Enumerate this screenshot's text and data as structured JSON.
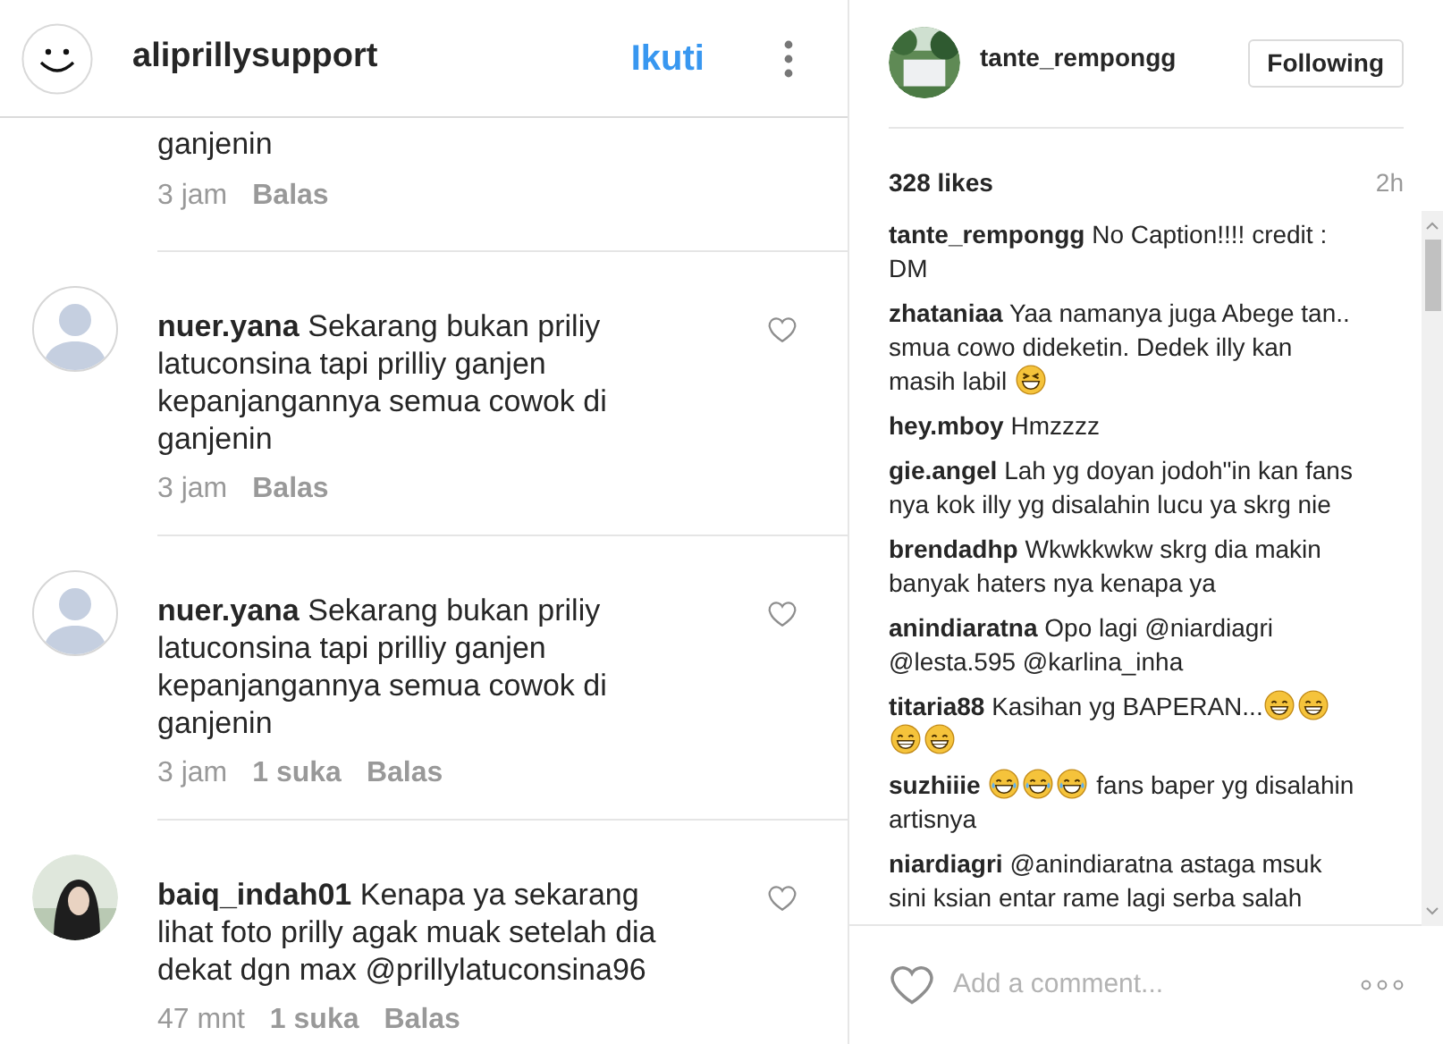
{
  "left": {
    "header": {
      "username": "aliprillysupport",
      "follow": "Ikuti"
    },
    "partial_comment": {
      "text": "ganjenin",
      "time": "3 jam",
      "reply": "Balas"
    },
    "comments": [
      {
        "avatar": {
          "kind": "default"
        },
        "username": "nuer.yana",
        "text": "Sekarang bukan priliy latuconsina tapi prilliy ganjen kepanjangannya semua cowok di ganjenin",
        "time": "3 jam",
        "reply": "Balas"
      },
      {
        "avatar": {
          "kind": "default"
        },
        "username": "nuer.yana",
        "text": "Sekarang bukan priliy latuconsina tapi prilliy ganjen kepanjangannya semua cowok di ganjenin",
        "time": "3 jam",
        "likes": "1 suka",
        "reply": "Balas"
      },
      {
        "username": "baiq_indah01",
        "text": "Kenapa ya sekarang lihat foto prilly agak muak setelah dia dekat dgn max @prillylatuconsina96",
        "time": "47 mnt",
        "likes": "1 suka",
        "reply": "Balas"
      }
    ]
  },
  "right": {
    "header": {
      "username": "tante_rempongg",
      "button": "Following"
    },
    "likes": "328 likes",
    "time": "2h",
    "comments": [
      {
        "username": "tante_rempongg",
        "parts": [
          {
            "kind": "text",
            "text": "No Caption!!!! credit : DM"
          }
        ]
      },
      {
        "username": "zhataniaa",
        "parts": [
          {
            "kind": "text",
            "text": "Yaa namanya juga Abege tan.. smua cowo dideketin. Dedek illy kan masih labil "
          },
          {
            "kind": "squint-emoji"
          }
        ]
      },
      {
        "username": "hey.mboy",
        "parts": [
          {
            "kind": "text",
            "text": "Hmzzzz"
          }
        ]
      },
      {
        "username": "gie.angel",
        "parts": [
          {
            "kind": "text",
            "text": "Lah yg doyan jodoh\"in kan fans nya kok illy yg disalahin lucu ya skrg nie"
          }
        ]
      },
      {
        "username": "brendadhp",
        "parts": [
          {
            "kind": "text",
            "text": "Wkwkkwkw skrg dia makin banyak haters nya kenapa ya"
          }
        ]
      },
      {
        "username": "anindiaratna",
        "parts": [
          {
            "kind": "text",
            "text": "Opo lagi @niardiagri @lesta.595 @karlina_inha"
          }
        ]
      },
      {
        "username": "titaria88",
        "parts": [
          {
            "kind": "text",
            "text": "Kasihan yg BAPERAN..."
          },
          {
            "kind": "grin-emoji"
          },
          {
            "kind": "grin-emoji"
          },
          {
            "kind": "grin-emoji"
          },
          {
            "kind": "grin-emoji"
          }
        ]
      },
      {
        "username": "suzhiiie",
        "parts": [
          {
            "kind": "joy-emoji"
          },
          {
            "kind": "joy-emoji"
          },
          {
            "kind": "joy-emoji"
          },
          {
            "kind": "text",
            "text": " fans baper yg disalahin artisnya"
          }
        ]
      },
      {
        "username": "niardiagri",
        "parts": [
          {
            "kind": "text",
            "text": "@anindiaratna astaga msuk sini ksian entar rame lagi serba salah"
          }
        ]
      }
    ],
    "add_comment": {
      "placeholder": "Add a comment..."
    }
  }
}
